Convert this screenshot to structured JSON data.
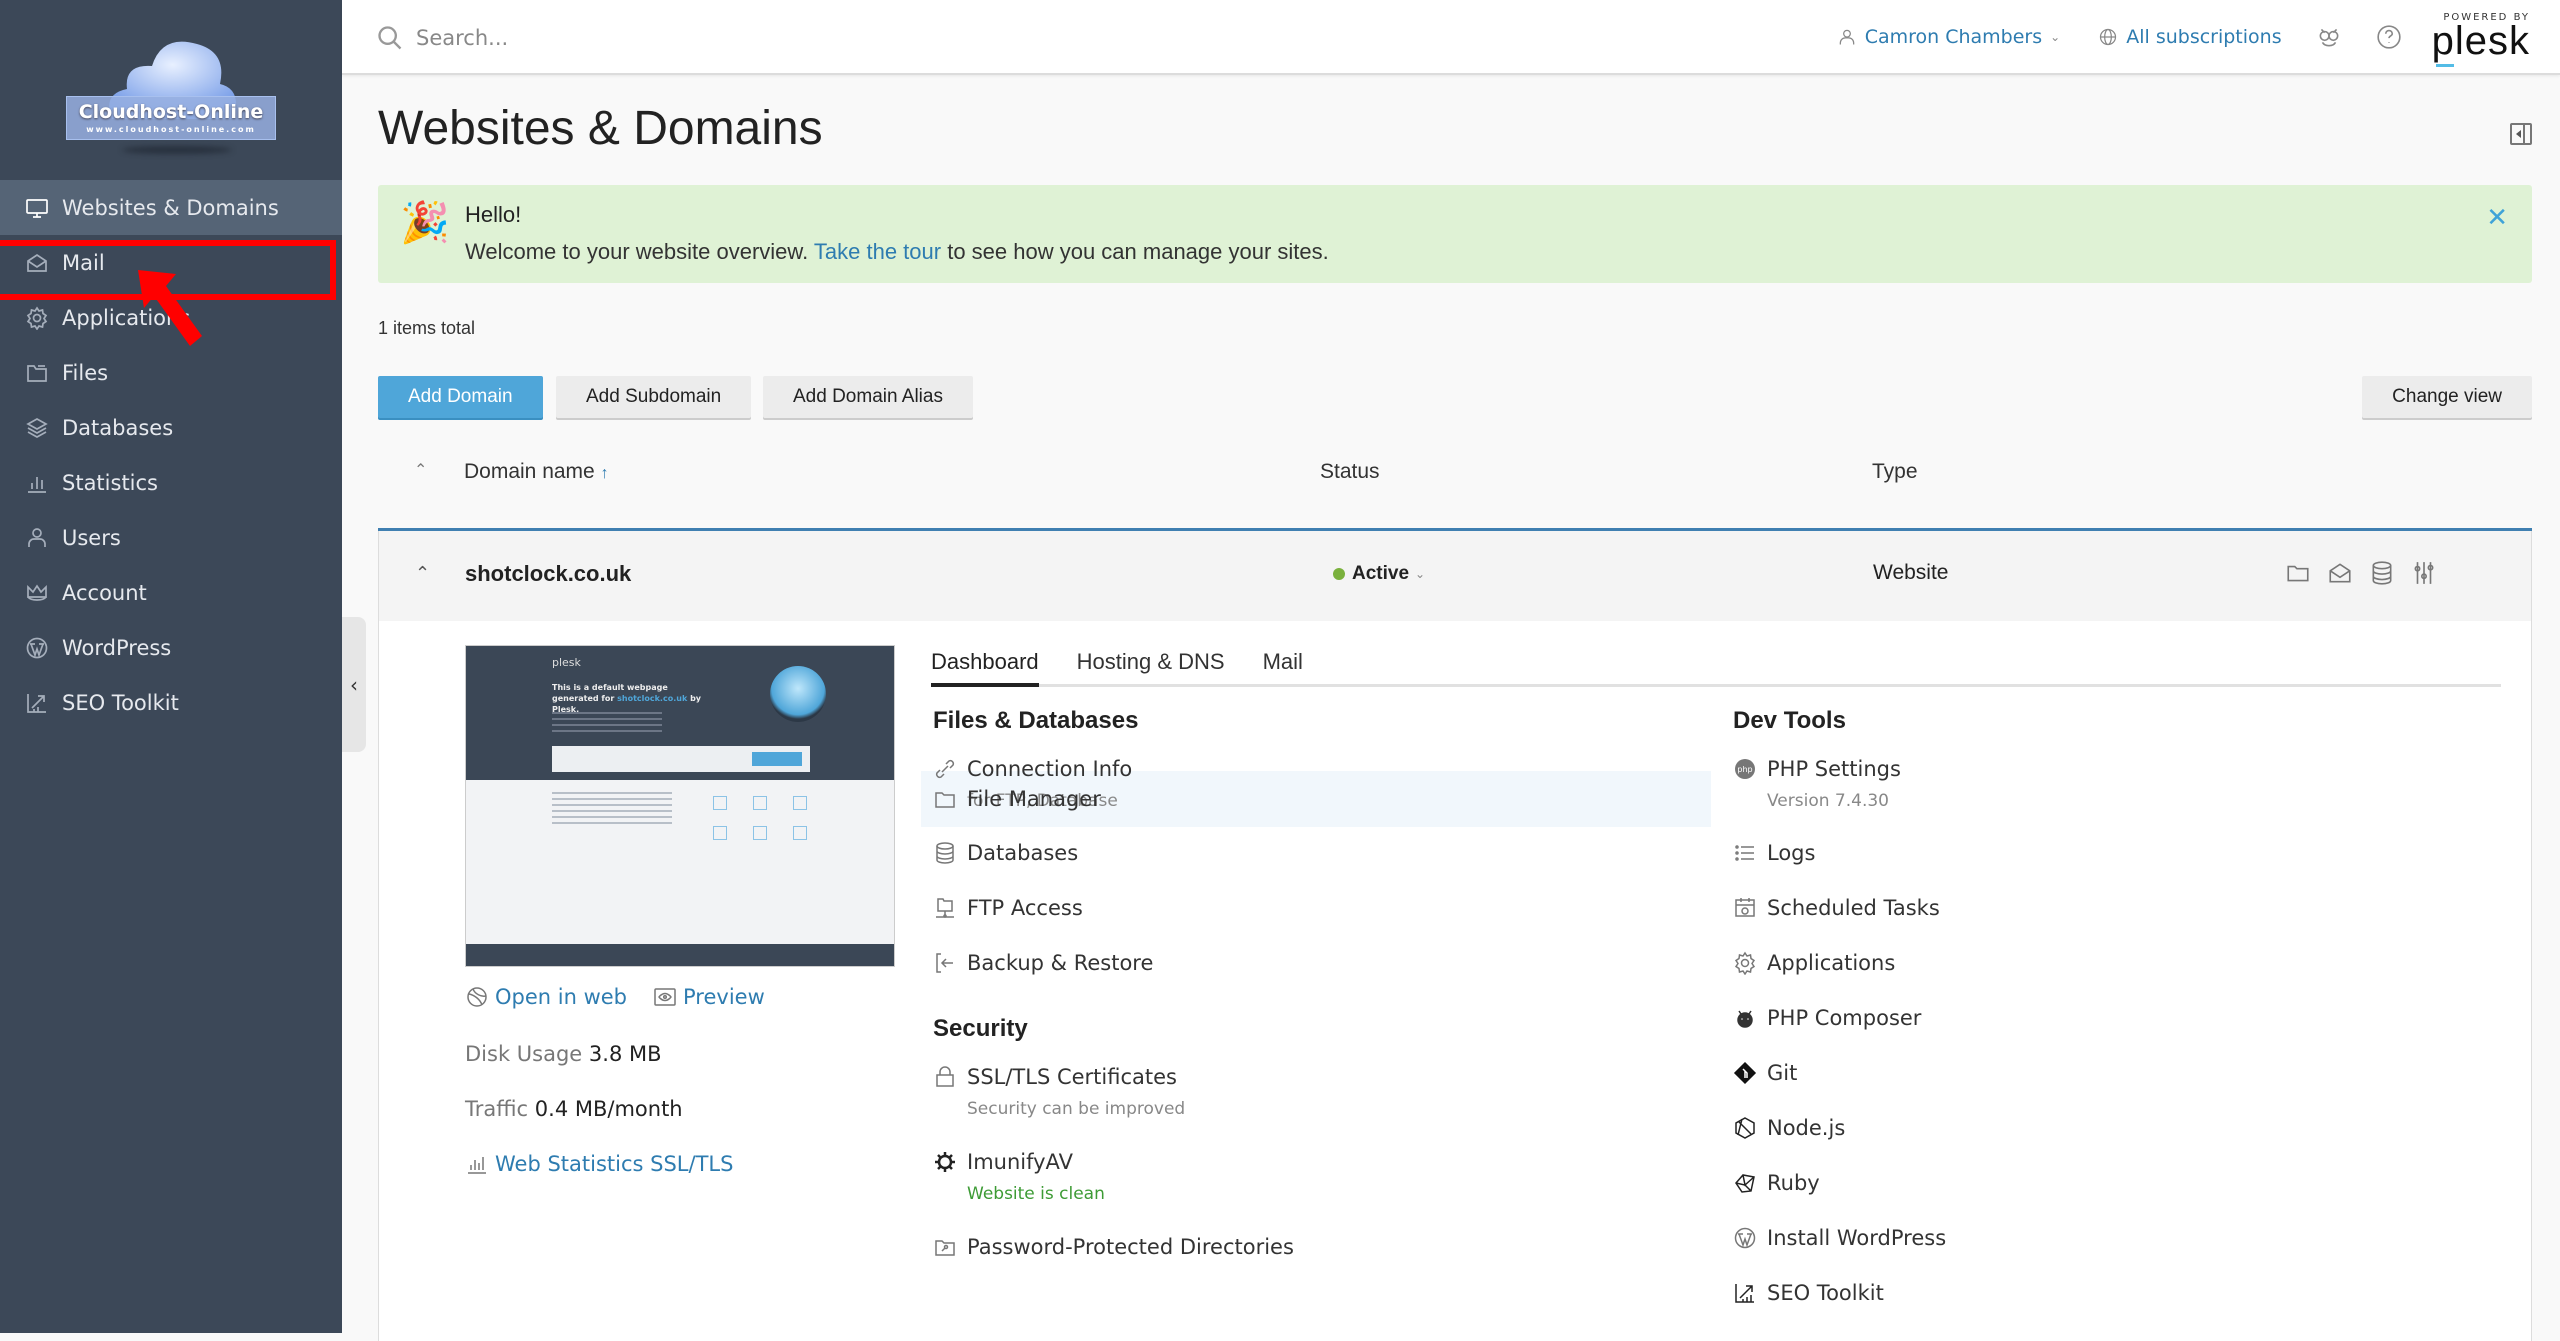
{
  "brand": {
    "logo_text": "Cloudhost-Online",
    "logo_url_text": "www.cloudhost-online.com"
  },
  "sidebar": {
    "items": [
      {
        "label": "Websites & Domains",
        "icon": "monitor-icon",
        "active": true
      },
      {
        "label": "Mail",
        "icon": "mail-icon",
        "active": false
      },
      {
        "label": "Applications",
        "icon": "gear-icon",
        "active": false
      },
      {
        "label": "Files",
        "icon": "folder-icon",
        "active": false
      },
      {
        "label": "Databases",
        "icon": "layers-icon",
        "active": false
      },
      {
        "label": "Statistics",
        "icon": "bar-chart-icon",
        "active": false
      },
      {
        "label": "Users",
        "icon": "user-icon",
        "active": false
      },
      {
        "label": "Account",
        "icon": "crown-icon",
        "active": false
      },
      {
        "label": "WordPress",
        "icon": "wordpress-icon",
        "active": false
      },
      {
        "label": "SEO Toolkit",
        "icon": "seo-chart-icon",
        "active": false
      }
    ],
    "collapse_glyph": "‹"
  },
  "annotation": {
    "highlight_target": "Mail",
    "color": "#ff0000"
  },
  "topbar": {
    "search_placeholder": "Search...",
    "user_name": "Camron Chambers",
    "subscriptions": "All subscriptions",
    "powered_by": "POWERED BY",
    "plesk": "plesk"
  },
  "page": {
    "title": "Websites & Domains",
    "alert": {
      "icon": "🎉",
      "title": "Hello!",
      "text_before": "Welcome to your website overview. ",
      "link": "Take the tour",
      "text_after": " to see how you can manage your sites.",
      "close": "✕"
    },
    "items_total": "1 items total",
    "buttons": {
      "add_domain": "Add Domain",
      "add_subdomain": "Add Subdomain",
      "add_alias": "Add Domain Alias",
      "change_view": "Change view"
    },
    "columns": {
      "collapse_all": "≈",
      "domain": "Domain name",
      "sort_glyph": "↑",
      "status": "Status",
      "type": "Type"
    }
  },
  "domain": {
    "name": "shotclock.co.uk",
    "status": "Active",
    "status_color": "#7ab13d",
    "type": "Website",
    "thumb": {
      "brand": "plesk",
      "headline": "This is a default webpage generated for",
      "domain": "shotclock.co.uk",
      "by": "by Plesk."
    },
    "open_in_web": "Open in web",
    "preview": "Preview",
    "disk_label": "Disk Usage",
    "disk_value": "3.8 MB",
    "traffic_label": "Traffic",
    "traffic_value": "0.4 MB/month",
    "webstats": "Web Statistics SSL/TLS",
    "tabs": [
      "Dashboard",
      "Hosting & DNS",
      "Mail"
    ],
    "active_tab": "Dashboard",
    "files_db": {
      "title": "Files & Databases",
      "items": [
        {
          "label": "Connection Info",
          "sub": "for FTP, Database"
        },
        {
          "label": "File Manager"
        },
        {
          "label": "Databases"
        },
        {
          "label": "FTP Access"
        },
        {
          "label": "Backup & Restore"
        }
      ]
    },
    "security": {
      "title": "Security",
      "items": [
        {
          "label": "SSL/TLS Certificates",
          "sub": "Security can be improved"
        },
        {
          "label": "ImunifyAV",
          "sub": "Website is clean"
        },
        {
          "label": "Password-Protected Directories"
        }
      ]
    },
    "dev_tools": {
      "title": "Dev Tools",
      "items": [
        {
          "label": "PHP Settings",
          "sub": "Version 7.4.30"
        },
        {
          "label": "Logs"
        },
        {
          "label": "Scheduled Tasks"
        },
        {
          "label": "Applications"
        },
        {
          "label": "PHP Composer"
        },
        {
          "label": "Git"
        },
        {
          "label": "Node.js"
        },
        {
          "label": "Ruby"
        },
        {
          "label": "Install WordPress"
        },
        {
          "label": "SEO Toolkit"
        }
      ]
    }
  }
}
